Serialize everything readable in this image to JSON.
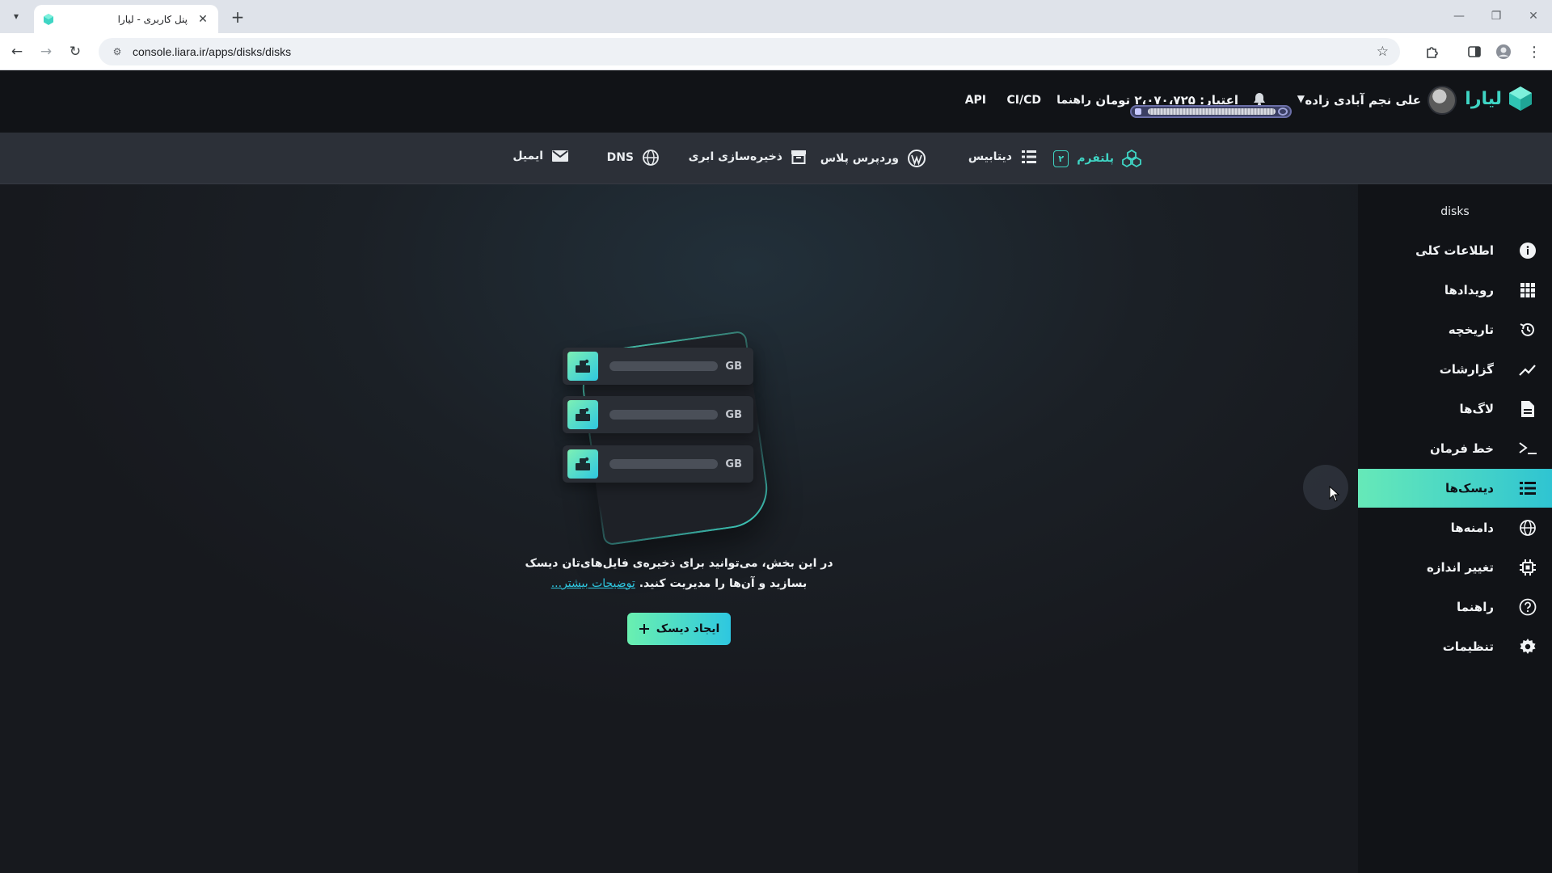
{
  "browser": {
    "tab_title": "پنل کاربری - لیارا",
    "url": "console.liara.ir/apps/disks/disks",
    "icons": [
      "tab-list-icon",
      "favicon-icon",
      "close-icon",
      "plus-icon",
      "minimize-icon",
      "restore-icon",
      "close-window-icon",
      "back-icon",
      "forward-icon",
      "reload-icon",
      "site-info-icon",
      "star-icon",
      "extensions-icon",
      "side-panel-icon",
      "profile-icon",
      "menu-icon"
    ]
  },
  "header": {
    "brand": "لیارا",
    "user_name": "علی نجم آبادی زاده",
    "credit": "اعتبار: ۲،۰۷۰،۷۲۵ تومان",
    "links": {
      "guide": "راهنما",
      "cicd": "CI/CD",
      "api": "API"
    },
    "accent_color": "#3fd5c4"
  },
  "topnav": {
    "items": [
      {
        "label": "پلتفرم",
        "badge": "۲",
        "icon": "platform-icon",
        "active": true
      },
      {
        "label": "دیتابیس",
        "icon": "database-icon"
      },
      {
        "label": "وردپرس پلاس",
        "icon": "wordpress-icon"
      },
      {
        "label": "ذخیره‌سازی ابری",
        "icon": "archive-icon"
      },
      {
        "label": "DNS",
        "icon": "globe-icon"
      },
      {
        "label": "ایمیل",
        "icon": "mail-icon"
      }
    ]
  },
  "sidebar": {
    "heading": "disks",
    "items": [
      {
        "label": "اطلاعات کلی",
        "icon": "info-icon"
      },
      {
        "label": "رویدادها",
        "icon": "grid-icon"
      },
      {
        "label": "تاریخچه",
        "icon": "history-icon"
      },
      {
        "label": "گزارشات",
        "icon": "chart-line-icon"
      },
      {
        "label": "لاگ‌ها",
        "icon": "file-icon"
      },
      {
        "label": "خط فرمان",
        "icon": "terminal-icon"
      },
      {
        "label": "دیسک‌ها",
        "icon": "disks-icon",
        "active": true
      },
      {
        "label": "دامنه‌ها",
        "icon": "globe-icon"
      },
      {
        "label": "تغییر اندازه",
        "icon": "chip-icon"
      },
      {
        "label": "راهنما",
        "icon": "help-icon"
      },
      {
        "label": "تنظیمات",
        "icon": "settings-icon"
      }
    ]
  },
  "main": {
    "disk_unit": "GB",
    "empty_text_line1": "در این بخش، می‌توانید برای ذخیره‌ی فایل‌های‌تان دیسک",
    "empty_text_line2": "بسازید و آن‌ها را مدیریت کنید.",
    "learn_more": "توضیحات بیشتر...",
    "create_button": "ایجاد دیسک"
  }
}
